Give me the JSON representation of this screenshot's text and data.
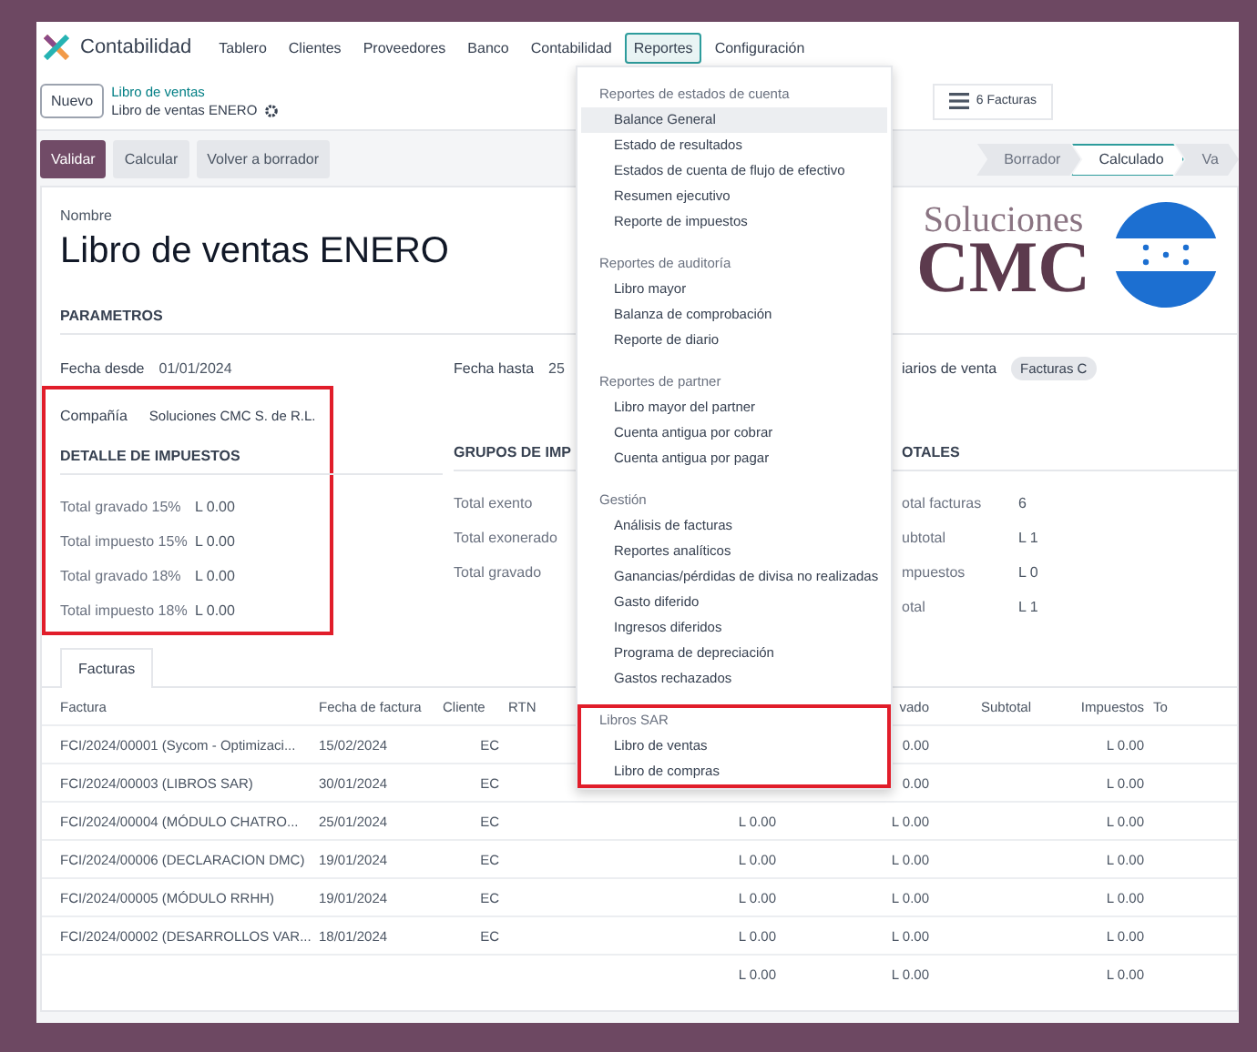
{
  "app": {
    "name": "Contabilidad"
  },
  "nav": [
    {
      "label": "Tablero",
      "selected": false
    },
    {
      "label": "Clientes",
      "selected": false
    },
    {
      "label": "Proveedores",
      "selected": false
    },
    {
      "label": "Banco",
      "selected": false
    },
    {
      "label": "Contabilidad",
      "selected": false
    },
    {
      "label": "Reportes",
      "selected": true
    },
    {
      "label": "Configuración",
      "selected": false
    }
  ],
  "breadcrumb": {
    "new_button": "Nuevo",
    "parent": "Libro de ventas",
    "current": "Libro de ventas ENERO"
  },
  "smart_button": {
    "label": "6 Facturas"
  },
  "actions": [
    {
      "label": "Validar",
      "primary": true
    },
    {
      "label": "Calcular",
      "primary": false
    },
    {
      "label": "Volver a borrador",
      "primary": false
    }
  ],
  "status_steps": [
    {
      "label": "Borrador",
      "selected": false
    },
    {
      "label": "Calculado",
      "selected": true
    },
    {
      "label": "Va",
      "selected": false
    }
  ],
  "form": {
    "name_label": "Nombre",
    "name": "Libro de ventas ENERO",
    "logo": {
      "line_1": "Soluciones",
      "line_2": "CMC"
    },
    "parameters": {
      "title": "PARAMETROS",
      "fields": [
        {
          "label": "Fecha desde",
          "value": "01/01/2024"
        },
        {
          "label": "Fecha hasta",
          "value": "25"
        },
        {
          "label": "iarios de venta",
          "tag": "Facturas C"
        }
      ]
    },
    "highlighted_block": {
      "highlighted": true,
      "company": {
        "label": "Compañía",
        "value": "Soluciones CMC S. de R.L."
      },
      "section": {
        "title": "DETALLE DE IMPUESTOS",
        "rows": [
          {
            "label": "Total gravado 15%",
            "value": "L 0.00"
          },
          {
            "label": "Total impuesto 15%",
            "value": "L 0.00"
          },
          {
            "label": "Total gravado 18%",
            "value": "L 0.00"
          },
          {
            "label": "Total impuesto 18%",
            "value": "L 0.00"
          }
        ]
      }
    },
    "sections": [
      {
        "title": "GRUPOS DE IMP",
        "rows": [
          {
            "label": "Total exento"
          },
          {
            "label": "Total exonerado"
          },
          {
            "label": "Total gravado"
          }
        ]
      },
      {
        "title": "OTALES",
        "rows": [
          {
            "label": "otal facturas",
            "value": "6"
          },
          {
            "label": "ubtotal",
            "value": "L 1"
          },
          {
            "label": "mpuestos",
            "value": "L 0"
          },
          {
            "label": "otal",
            "value": "L 1"
          }
        ]
      }
    ]
  },
  "tabs": [
    {
      "label": "Facturas",
      "selected": true
    }
  ],
  "table": {
    "columns": [
      {
        "label": "Factura"
      },
      {
        "label": "Fecha de factura"
      },
      {
        "label": "Cliente"
      },
      {
        "label": "RTN"
      },
      {},
      {
        "label": "vado"
      },
      {
        "label": "Subtotal"
      },
      {
        "label": "Impuestos"
      },
      {
        "label": "To"
      }
    ],
    "rows": [
      {
        "factura": "FCI/2024/00001 (Sycom - Optimizaci...",
        "fecha": "15/02/2024",
        "cliente": "EC",
        "gravado": "0.00",
        "impuestos": "L 0.00"
      },
      {
        "factura": "FCI/2024/00003 (LIBROS SAR)",
        "fecha": "30/01/2024",
        "cliente": "EC",
        "gravado": "0.00",
        "impuestos": "L 0.00"
      },
      {
        "factura": "FCI/2024/00004 (MÓDULO CHATRO...",
        "fecha": "25/01/2024",
        "cliente": "EC",
        "exento": "L 0.00",
        "gravado": "L 0.00",
        "impuestos": "L 0.00"
      },
      {
        "factura": "FCI/2024/00006 (DECLARACION DMC)",
        "fecha": "19/01/2024",
        "cliente": "EC",
        "exento": "L 0.00",
        "gravado": "L 0.00",
        "impuestos": "L 0.00"
      },
      {
        "factura": "FCI/2024/00005 (MÓDULO RRHH)",
        "fecha": "19/01/2024",
        "cliente": "EC",
        "exento": "L 0.00",
        "gravado": "L 0.00",
        "impuestos": "L 0.00"
      },
      {
        "factura": "FCI/2024/00002 (DESARROLLOS VAR...",
        "fecha": "18/01/2024",
        "cliente": "EC",
        "exento": "L 0.00",
        "gravado": "L 0.00",
        "impuestos": "L 0.00"
      }
    ],
    "totals": {
      "exento": "L 0.00",
      "gravado": "L 0.00",
      "impuestos": "L 0.00"
    }
  },
  "dropdown": {
    "sections": [
      {
        "header": "Reportes de estados de cuenta",
        "highlighted": false,
        "items": [
          {
            "label": "Balance General",
            "selected": true
          },
          {
            "label": "Estado de resultados",
            "selected": false
          },
          {
            "label": "Estados de cuenta de flujo de efectivo",
            "selected": false
          },
          {
            "label": "Resumen ejecutivo",
            "selected": false
          },
          {
            "label": "Reporte de impuestos",
            "selected": false
          }
        ]
      },
      {
        "header": "Reportes de auditoría",
        "highlighted": false,
        "items": [
          {
            "label": "Libro mayor",
            "selected": false
          },
          {
            "label": "Balanza de comprobación",
            "selected": false
          },
          {
            "label": "Reporte de diario",
            "selected": false
          }
        ]
      },
      {
        "header": "Reportes de partner",
        "highlighted": false,
        "items": [
          {
            "label": "Libro mayor del partner",
            "selected": false
          },
          {
            "label": "Cuenta antigua por cobrar",
            "selected": false
          },
          {
            "label": "Cuenta antigua por pagar",
            "selected": false
          }
        ]
      },
      {
        "header": "Gestión",
        "highlighted": false,
        "items": [
          {
            "label": "Análisis de facturas",
            "selected": false
          },
          {
            "label": "Reportes analíticos",
            "selected": false
          },
          {
            "label": "Ganancias/pérdidas de divisa no realizadas",
            "selected": false
          },
          {
            "label": "Gasto diferido",
            "selected": false
          },
          {
            "label": "Ingresos diferidos",
            "selected": false
          },
          {
            "label": "Programa de depreciación",
            "selected": false
          },
          {
            "label": "Gastos rechazados",
            "selected": false
          }
        ]
      },
      {
        "header": "Libros SAR",
        "highlighted": true,
        "items": [
          {
            "label": "Libro de ventas",
            "selected": false
          },
          {
            "label": "Libro de compras",
            "selected": false
          }
        ]
      }
    ]
  }
}
